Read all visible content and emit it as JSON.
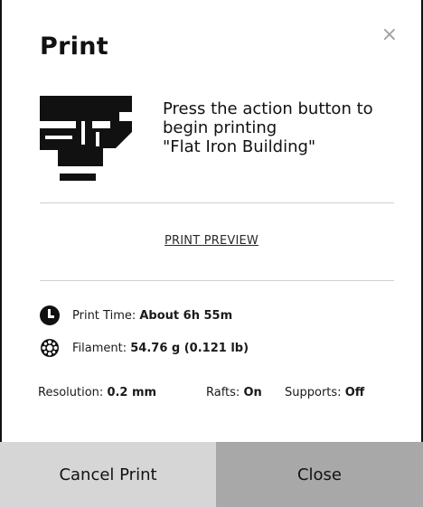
{
  "dialog": {
    "title": "Print",
    "close_glyph": "×",
    "message_line1": "Press the action button to",
    "message_line2": "begin printing",
    "message_line3": "\"Flat Iron Building\"",
    "preview_link": "PRINT PREVIEW"
  },
  "info": {
    "time_label": "Print Time:",
    "time_value": "About 6h 55m",
    "filament_label": "Filament:",
    "filament_value": "54.76 g (0.121 lb)"
  },
  "specs": {
    "resolution_label": "Resolution:",
    "resolution_value": "0.2 mm",
    "rafts_label": "Rafts:",
    "rafts_value": "On",
    "supports_label": "Supports:",
    "supports_value": "Off"
  },
  "buttons": {
    "cancel": "Cancel Print",
    "close": "Close"
  },
  "icons": {
    "printer": "printer-press-icon",
    "clock": "clock-icon",
    "filament": "filament-spool-icon",
    "close": "close-icon"
  },
  "colors": {
    "cancel_bg": "#d6d6d6",
    "close_bg": "#a8a8a8",
    "divider": "#cfcfcf"
  }
}
